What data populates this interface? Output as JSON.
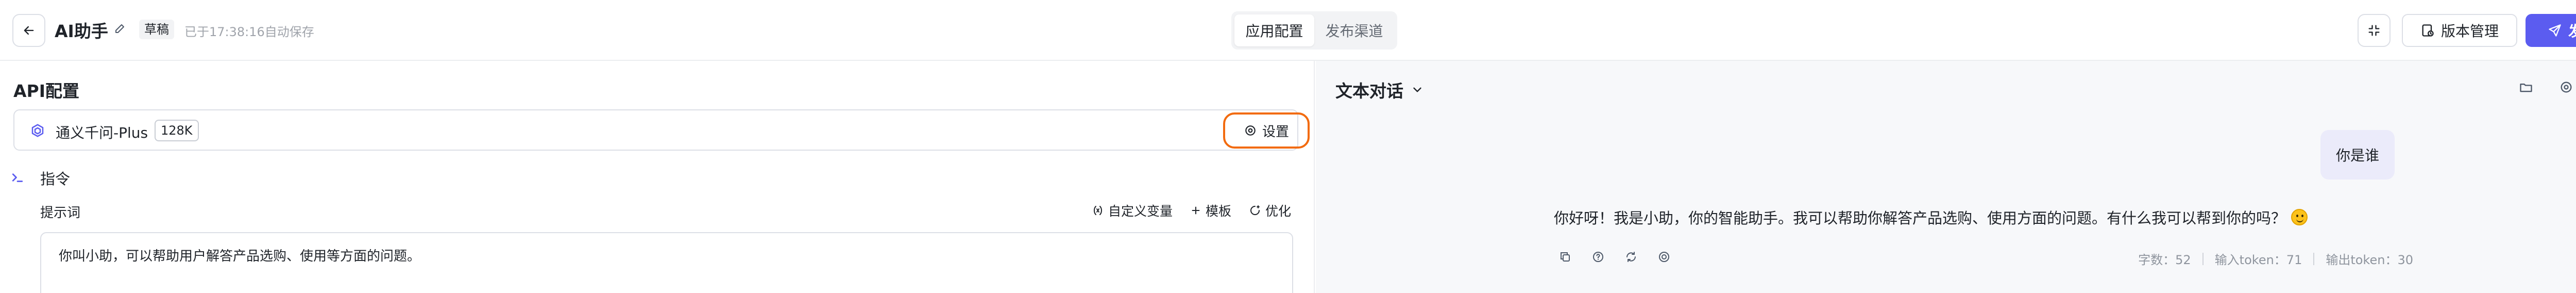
{
  "header": {
    "title": "AI助手",
    "status_badge": "草稿",
    "autosave_text": "已于17:38:16自动保存",
    "tabs": [
      {
        "label": "应用配置",
        "active": true
      },
      {
        "label": "发布渠道",
        "active": false
      }
    ],
    "version_label": "版本管理",
    "publish_label": "发布",
    "accent_color": "#5b5cf0"
  },
  "config": {
    "section_title": "API配置",
    "model": {
      "name": "通义千问-Plus",
      "tag": "128K",
      "settings_label": "设置",
      "highlight_color": "#f26b0f"
    },
    "instruction": {
      "label": "指令",
      "prompt_label": "提示词",
      "tools": {
        "variables": "自定义变量",
        "template": "模板",
        "optimize": "优化"
      },
      "prompt_text": "你叫小助，可以帮助用户解答产品选购、使用等方面的问题。"
    }
  },
  "chat": {
    "mode_label": "文本对话",
    "messages": [
      {
        "role": "user",
        "text": "你是谁"
      },
      {
        "role": "assistant",
        "text": "你好呀！我是小助，你的智能助手。我可以帮助你解答产品选购、使用方面的问题。有什么我可以帮到你的吗？"
      }
    ],
    "stats": {
      "chars": "字数：52",
      "input_tokens": "输入token：71",
      "output_tokens": "输出token：30"
    }
  }
}
